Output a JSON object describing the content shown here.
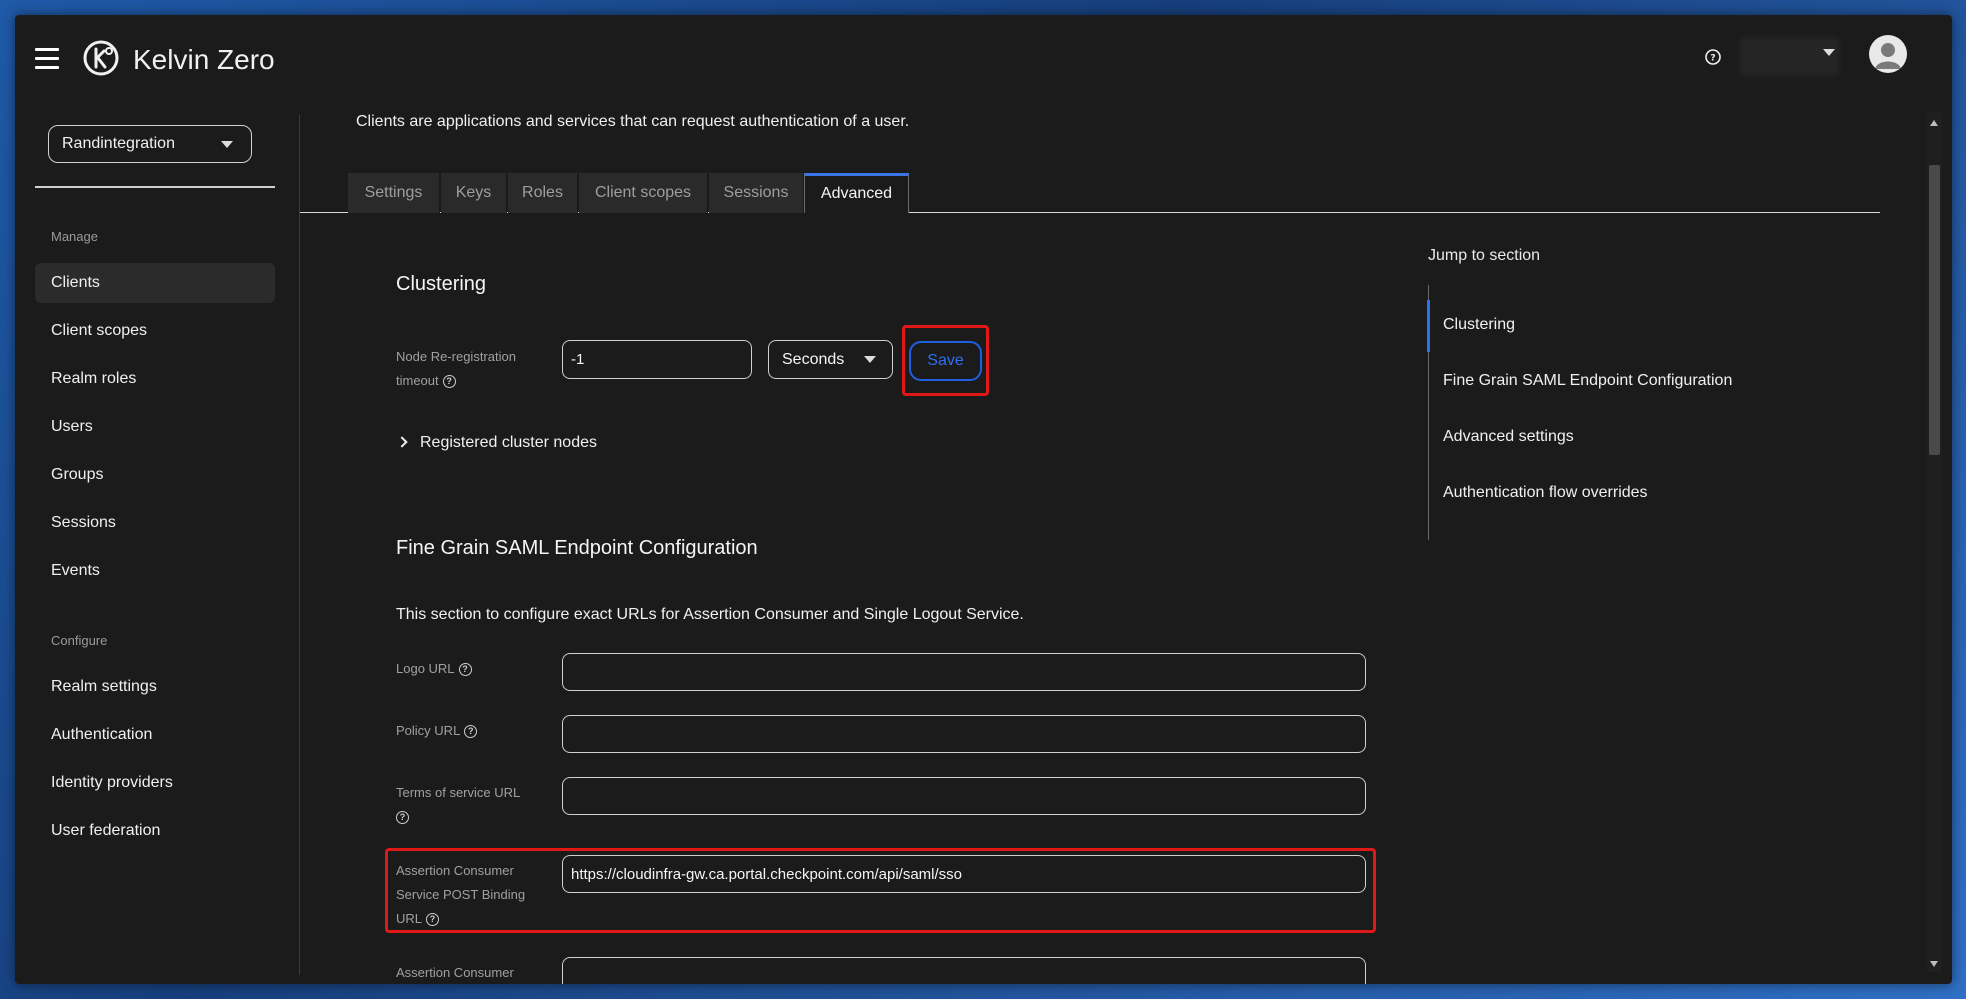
{
  "header": {
    "brand": "Kelvin Zero",
    "help_icon": "question-circle-icon",
    "avatar_icon": "user-avatar-icon"
  },
  "sidebar": {
    "realm": "Randintegration",
    "manage_label": "Manage",
    "manage_items": [
      "Clients",
      "Client scopes",
      "Realm roles",
      "Users",
      "Groups",
      "Sessions",
      "Events"
    ],
    "configure_label": "Configure",
    "configure_items": [
      "Realm settings",
      "Authentication",
      "Identity providers",
      "User federation"
    ],
    "active_item": "Clients"
  },
  "main": {
    "intro": "Clients are applications and services that can request authentication of a user.",
    "tabs": [
      "Settings",
      "Keys",
      "Roles",
      "Client scopes",
      "Sessions",
      "Advanced"
    ],
    "active_tab": "Advanced",
    "clustering": {
      "title": "Clustering",
      "timeout_label": "Node Re-registration timeout",
      "timeout_value": "-1",
      "unit": "Seconds",
      "save_label": "Save",
      "registered_nodes": "Registered cluster nodes"
    },
    "saml": {
      "title": "Fine Grain SAML Endpoint Configuration",
      "description": "This section to configure exact URLs for Assertion Consumer and Single Logout Service.",
      "logo_url_label": "Logo URL",
      "logo_url_value": "",
      "policy_url_label": "Policy URL",
      "policy_url_value": "",
      "tos_url_label": "Terms of service URL",
      "tos_url_value": "",
      "acs_post_label": "Assertion Consumer Service POST Binding URL",
      "acs_post_value": "https://cloudinfra-gw.ca.portal.checkpoint.com/api/saml/sso",
      "acs_redirect_label_partial": "Assertion Consumer"
    }
  },
  "jump": {
    "title": "Jump to section",
    "items": [
      "Clustering",
      "Fine Grain SAML Endpoint Configuration",
      "Advanced settings",
      "Authentication flow overrides"
    ],
    "active": "Clustering"
  },
  "colors": {
    "accent": "#2f6ff0",
    "highlight": "#e01818",
    "background": "#1b1b1b"
  }
}
